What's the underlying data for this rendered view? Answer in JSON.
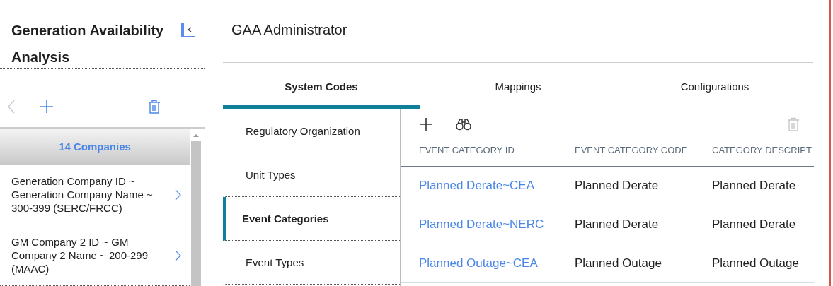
{
  "sidebar": {
    "title": "Generation Availability Analysis",
    "toolbar": [
      {
        "kind": "back",
        "disabled": true
      },
      {
        "kind": "add",
        "disabled": false
      },
      {
        "kind": "delete",
        "disabled": false
      }
    ],
    "list_header": "14 Companies",
    "items": [
      {
        "label": "Generation Company ID ~ Generation Company Name ~ 300-399 (SERC/FRCC)"
      },
      {
        "label": "GM Company 2 ID ~ GM Company 2 Name ~ 200-299 (MAAC)"
      }
    ]
  },
  "main": {
    "title": "GAA Administrator",
    "tabs": [
      {
        "label": "System Codes",
        "selected": true
      },
      {
        "label": "Mappings",
        "selected": false
      },
      {
        "label": "Configurations",
        "selected": false
      }
    ],
    "nav": [
      {
        "label": "Regulatory Organization",
        "selected": false
      },
      {
        "label": "Unit Types",
        "selected": false
      },
      {
        "label": "Event Categories",
        "selected": true
      },
      {
        "label": "Event Types",
        "selected": false
      }
    ],
    "toolbar": [
      {
        "kind": "add",
        "disabled": false
      },
      {
        "kind": "search",
        "disabled": false
      },
      {
        "kind": "delete",
        "disabled": true
      }
    ],
    "table": {
      "columns": [
        "EVENT CATEGORY ID",
        "EVENT CATEGORY CODE",
        "CATEGORY DESCRIPT"
      ],
      "rows": [
        [
          "Planned Derate~CEA",
          "Planned Derate",
          "Planned Derate"
        ],
        [
          "Planned Derate~NERC",
          "Planned Derate",
          "Planned Derate"
        ],
        [
          "Planned Outage~CEA",
          "Planned Outage",
          "Planned Outage"
        ]
      ]
    }
  }
}
